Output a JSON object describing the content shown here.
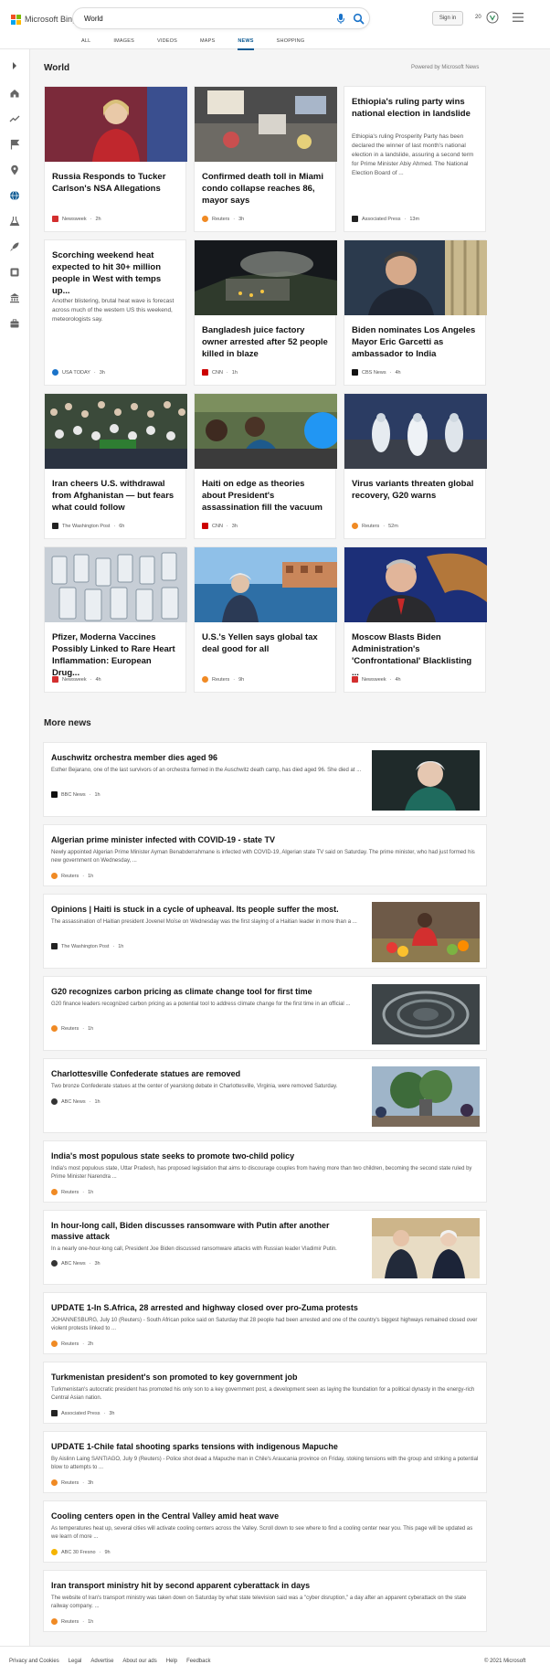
{
  "header": {
    "logo_text": "Microsoft Bing",
    "search_value": "World",
    "sign_in": "Sign in",
    "rewards_count": "20",
    "tabs": [
      "ALL",
      "IMAGES",
      "VIDEOS",
      "MAPS",
      "NEWS",
      "SHOPPING"
    ],
    "active_tab": "NEWS"
  },
  "colors": {
    "accent": "#0c5a93",
    "search_icon": "#1a73c9"
  },
  "rail": {
    "icons": [
      "expand-icon",
      "home-icon",
      "trending-icon",
      "flag-icon",
      "location-icon",
      "globe-icon",
      "science-icon",
      "rocket-icon",
      "entertainment-icon",
      "politics-icon",
      "business-icon"
    ]
  },
  "world": {
    "title": "World",
    "powered_by": "Powered by Microsoft News",
    "cards": [
      {
        "headline": "Russia Responds to Tucker Carlson's NSA Allegations",
        "source": "Newsweek",
        "time": "2h"
      },
      {
        "headline": "Confirmed death toll in Miami condo collapse reaches 86, mayor says",
        "source": "Reuters",
        "time": "3h"
      },
      {
        "headline": "Ethiopia's ruling party wins national election in landslide",
        "snippet": "Ethiopia's ruling Prosperity Party has been declared the winner of last month's national election in a landslide, assuring a second term for Prime Minister Abiy Ahmed. The National Election Board of ...",
        "source": "Associated Press",
        "time": "13m"
      },
      {
        "headline": "Scorching weekend heat expected to hit 30+ million people in West with temps up...",
        "snippet": "Another blistering, brutal heat wave is forecast across much of the western US this weekend, meteorologists say.",
        "source": "USA TODAY",
        "time": "3h"
      },
      {
        "headline": "Bangladesh juice factory owner arrested after 52 people killed in blaze",
        "source": "CNN",
        "time": "1h"
      },
      {
        "headline": "Biden nominates Los Angeles Mayor Eric Garcetti as ambassador to India",
        "source": "CBS News",
        "time": "4h"
      },
      {
        "headline": "Iran cheers U.S. withdrawal from Afghanistan — but fears what could follow",
        "source": "The Washington Post",
        "time": "6h"
      },
      {
        "headline": "Haiti on edge as theories about President's assassination fill the vacuum",
        "source": "CNN",
        "time": "3h"
      },
      {
        "headline": "Virus variants threaten global recovery, G20 warns",
        "source": "Reuters",
        "time": "52m"
      },
      {
        "headline": "Pfizer, Moderna Vaccines Possibly Linked to Rare Heart Inflammation: European Drug...",
        "source": "Newsweek",
        "time": "4h"
      },
      {
        "headline": "U.S.'s Yellen says global tax deal good for all",
        "source": "Reuters",
        "time": "9h"
      },
      {
        "headline": "Moscow Blasts Biden Administration's 'Confrontational' Blacklisting ...",
        "source": "Newsweek",
        "time": "4h"
      }
    ]
  },
  "more_news": {
    "title": "More news",
    "items": [
      {
        "headline": "Auschwitz orchestra member dies aged 96",
        "snippet": "Esther Bejarano, one of the last survivors of an orchestra formed in the Auschwitz death camp, has died aged 96. She died at ...",
        "source": "BBC News",
        "time": "1h"
      },
      {
        "headline": "Algerian prime minister infected with COVID-19 - state TV",
        "snippet": "Newly appointed Algerian Prime Minister Ayman Benabderrahmane is infected with COVID-19, Algerian state TV said on Saturday. The prime minister, who had just formed his new government on Wednesday, ...",
        "source": "Reuters",
        "time": "1h"
      },
      {
        "headline": "Opinions | Haiti is stuck in a cycle of upheaval. Its people suffer the most.",
        "snippet": "The assassination of Haitian president Jovenel Moïse on Wednesday was the first slaying of a Haitian leader in more than a ...",
        "source": "The Washington Post",
        "time": "1h"
      },
      {
        "headline": "G20 recognizes carbon pricing as climate change tool for first time",
        "snippet": "G20 finance leaders recognized carbon pricing as a potential tool to address climate change for the first time in an official ...",
        "source": "Reuters",
        "time": "1h"
      },
      {
        "headline": "Charlottesville Confederate statues are removed",
        "snippet": "Two bronze Confederate statues at the center of yearslong debate in Charlottesville, Virginia, were removed Saturday.",
        "source": "ABC News",
        "time": "1h"
      },
      {
        "headline": "India's most populous state seeks to promote two-child policy",
        "snippet": "India's most populous state, Uttar Pradesh, has proposed legislation that aims to discourage couples from having more than two children, becoming the second state ruled by Prime Minister Narendra ...",
        "source": "Reuters",
        "time": "1h"
      },
      {
        "headline": "In hour-long call, Biden discusses ransomware with Putin after another massive attack",
        "snippet": "In a nearly one-hour-long call, President Joe Biden discussed ransomware attacks with Russian leader Vladimir Putin.",
        "source": "ABC News",
        "time": "3h"
      },
      {
        "headline": "UPDATE 1-In S.Africa, 28 arrested and highway closed over pro-Zuma protests",
        "snippet": "JOHANNESBURG, July 10 (Reuters) - South African police said on Saturday that 28 people had been arrested and one of the country's biggest highways remained closed over violent protests linked to ...",
        "source": "Reuters",
        "time": "2h"
      },
      {
        "headline": "Turkmenistan president's son promoted to key government job",
        "snippet": "Turkmenistan's autocratic president has promoted his only son to a key government post, a development seen as laying the foundation for a political dynasty in the energy-rich Central Asian nation.",
        "source": "Associated Press",
        "time": "3h"
      },
      {
        "headline": "UPDATE 1-Chile fatal shooting sparks tensions with indigenous Mapuche",
        "snippet": "By Aislinn Laing SANTIAGO, July 9 (Reuters) - Police shot dead a Mapuche man in Chile's Araucania province on Friday, stoking tensions with the group and striking a potential blow to attempts to ...",
        "source": "Reuters",
        "time": "3h"
      },
      {
        "headline": "Cooling centers open in the Central Valley amid heat wave",
        "snippet": "As temperatures heat up, several cities will activate cooling centers across the Valley. Scroll down to see where to find a cooling center near you. This page will be updated as we learn of more ...",
        "source": "ABC 30 Fresno",
        "time": "9h"
      },
      {
        "headline": "Iran transport ministry hit by second apparent cyberattack in days",
        "snippet": "The website of Iran's transport ministry was taken down on Saturday by what state television said was a \"cyber disruption,\" a day after an apparent cyberattack on the state railway company. ...",
        "source": "Reuters",
        "time": "1h"
      }
    ]
  },
  "footer": {
    "links": [
      "Privacy and Cookies",
      "Legal",
      "Advertise",
      "About our ads",
      "Help",
      "Feedback"
    ],
    "copyright": "© 2021 Microsoft"
  }
}
